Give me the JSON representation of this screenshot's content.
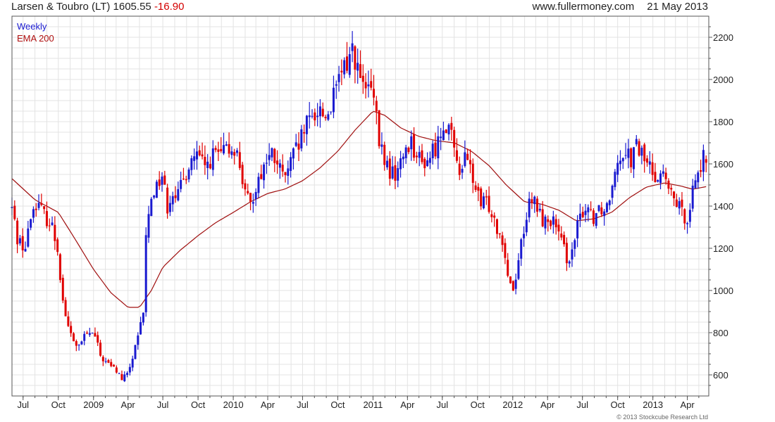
{
  "header": {
    "ticker_name": "Larsen & Toubro (LT)",
    "price": "1605.55",
    "change": "-16.90",
    "site": "www.fullermoney.com",
    "date": "21 May 2013"
  },
  "legend": {
    "weekly": "Weekly",
    "ema": "EMA 200"
  },
  "copyright": "© 2013 Stockcube Research Ltd",
  "colors": {
    "up": "#1a1ad0",
    "down": "#e00000",
    "ema": "#a01010",
    "grid": "#e3e3e3",
    "frame": "#555555",
    "weekly_label": "#1a1ad0",
    "ema_label": "#b01010"
  },
  "chart_data": {
    "type": "candlestick",
    "title": "Larsen & Toubro (LT) 1605.55 -16.90",
    "frequency": "Weekly",
    "x_tick_labels": [
      "Jul",
      "Oct",
      "2009",
      "Apr",
      "Jul",
      "Oct",
      "2010",
      "Apr",
      "Jul",
      "Oct",
      "2011",
      "Apr",
      "Jul",
      "Oct",
      "2012",
      "Apr",
      "Jul",
      "Oct",
      "2013",
      "Apr"
    ],
    "x_tick_dates": [
      "2008-07",
      "2008-10",
      "2009-01",
      "2009-04",
      "2009-07",
      "2009-10",
      "2010-01",
      "2010-04",
      "2010-07",
      "2010-10",
      "2011-01",
      "2011-04",
      "2011-07",
      "2011-10",
      "2012-01",
      "2012-04",
      "2012-07",
      "2012-10",
      "2013-01",
      "2013-04"
    ],
    "y_ticks": [
      600,
      800,
      1000,
      1200,
      1400,
      1600,
      1800,
      2000,
      2200
    ],
    "ylim": [
      500,
      2300
    ],
    "grid": true,
    "legend_position": "top-left",
    "price_path": [
      [
        "2008-06-02",
        1390
      ],
      [
        "2008-06-16",
        1250
      ],
      [
        "2008-07-07",
        1200
      ],
      [
        "2008-07-21",
        1350
      ],
      [
        "2008-08-04",
        1420
      ],
      [
        "2008-08-18",
        1380
      ],
      [
        "2008-09-01",
        1340
      ],
      [
        "2008-09-15",
        1300
      ],
      [
        "2008-09-29",
        1200
      ],
      [
        "2008-10-13",
        950
      ],
      [
        "2008-10-27",
        820
      ],
      [
        "2008-11-10",
        760
      ],
      [
        "2008-11-24",
        730
      ],
      [
        "2008-12-08",
        780
      ],
      [
        "2008-12-22",
        800
      ],
      [
        "2009-01-05",
        780
      ],
      [
        "2009-01-19",
        690
      ],
      [
        "2009-02-02",
        660
      ],
      [
        "2009-02-16",
        640
      ],
      [
        "2009-03-02",
        620
      ],
      [
        "2009-03-16",
        580
      ],
      [
        "2009-03-30",
        600
      ],
      [
        "2009-04-13",
        680
      ],
      [
        "2009-04-27",
        770
      ],
      [
        "2009-05-11",
        900
      ],
      [
        "2009-05-18",
        1250
      ],
      [
        "2009-06-01",
        1450
      ],
      [
        "2009-06-15",
        1500
      ],
      [
        "2009-06-29",
        1550
      ],
      [
        "2009-07-13",
        1400
      ],
      [
        "2009-07-27",
        1480
      ],
      [
        "2009-08-10",
        1450
      ],
      [
        "2009-08-24",
        1520
      ],
      [
        "2009-09-07",
        1600
      ],
      [
        "2009-09-21",
        1640
      ],
      [
        "2009-10-05",
        1620
      ],
      [
        "2009-10-19",
        1580
      ],
      [
        "2009-11-02",
        1620
      ],
      [
        "2009-11-16",
        1650
      ],
      [
        "2009-11-30",
        1640
      ],
      [
        "2009-12-14",
        1660
      ],
      [
        "2010-01-04",
        1680
      ],
      [
        "2010-01-18",
        1600
      ],
      [
        "2010-02-01",
        1450
      ],
      [
        "2010-02-15",
        1400
      ],
      [
        "2010-03-01",
        1500
      ],
      [
        "2010-03-15",
        1560
      ],
      [
        "2010-03-29",
        1620
      ],
      [
        "2010-04-12",
        1640
      ],
      [
        "2010-04-26",
        1600
      ],
      [
        "2010-05-10",
        1540
      ],
      [
        "2010-05-24",
        1560
      ],
      [
        "2010-06-07",
        1640
      ],
      [
        "2010-06-21",
        1680
      ],
      [
        "2010-07-05",
        1760
      ],
      [
        "2010-07-19",
        1800
      ],
      [
        "2010-08-02",
        1840
      ],
      [
        "2010-08-16",
        1860
      ],
      [
        "2010-08-30",
        1820
      ],
      [
        "2010-09-13",
        1880
      ],
      [
        "2010-09-27",
        1950
      ],
      [
        "2010-10-11",
        2030
      ],
      [
        "2010-10-25",
        2080
      ],
      [
        "2010-11-08",
        2150
      ],
      [
        "2010-11-22",
        2050
      ],
      [
        "2010-12-06",
        1950
      ],
      [
        "2010-12-20",
        1960
      ],
      [
        "2011-01-03",
        1900
      ],
      [
        "2011-01-17",
        1700
      ],
      [
        "2011-01-31",
        1620
      ],
      [
        "2011-02-14",
        1560
      ],
      [
        "2011-02-28",
        1550
      ],
      [
        "2011-03-14",
        1600
      ],
      [
        "2011-03-28",
        1680
      ],
      [
        "2011-04-11",
        1710
      ],
      [
        "2011-04-25",
        1640
      ],
      [
        "2011-05-09",
        1600
      ],
      [
        "2011-05-23",
        1620
      ],
      [
        "2011-06-06",
        1660
      ],
      [
        "2011-06-20",
        1700
      ],
      [
        "2011-07-04",
        1800
      ],
      [
        "2011-07-18",
        1780
      ],
      [
        "2011-08-01",
        1650
      ],
      [
        "2011-08-15",
        1580
      ],
      [
        "2011-08-29",
        1620
      ],
      [
        "2011-09-12",
        1580
      ],
      [
        "2011-09-26",
        1480
      ],
      [
        "2011-10-10",
        1400
      ],
      [
        "2011-10-24",
        1420
      ],
      [
        "2011-11-07",
        1380
      ],
      [
        "2011-11-21",
        1300
      ],
      [
        "2011-12-05",
        1250
      ],
      [
        "2011-12-19",
        1080
      ],
      [
        "2012-01-02",
        1000
      ],
      [
        "2012-01-16",
        1150
      ],
      [
        "2012-01-30",
        1300
      ],
      [
        "2012-02-13",
        1400
      ],
      [
        "2012-02-27",
        1420
      ],
      [
        "2012-03-12",
        1360
      ],
      [
        "2012-03-26",
        1320
      ],
      [
        "2012-04-09",
        1340
      ],
      [
        "2012-04-23",
        1300
      ],
      [
        "2012-05-07",
        1220
      ],
      [
        "2012-05-21",
        1160
      ],
      [
        "2012-06-04",
        1170
      ],
      [
        "2012-06-18",
        1300
      ],
      [
        "2012-07-02",
        1380
      ],
      [
        "2012-07-16",
        1400
      ],
      [
        "2012-07-30",
        1350
      ],
      [
        "2012-08-13",
        1400
      ],
      [
        "2012-08-27",
        1380
      ],
      [
        "2012-09-10",
        1450
      ],
      [
        "2012-09-24",
        1600
      ],
      [
        "2012-10-08",
        1640
      ],
      [
        "2012-10-22",
        1680
      ],
      [
        "2012-11-05",
        1620
      ],
      [
        "2012-11-19",
        1680
      ],
      [
        "2012-12-03",
        1650
      ],
      [
        "2012-12-17",
        1600
      ],
      [
        "2013-01-07",
        1550
      ],
      [
        "2013-01-21",
        1560
      ],
      [
        "2013-02-04",
        1520
      ],
      [
        "2013-02-18",
        1440
      ],
      [
        "2013-03-04",
        1420
      ],
      [
        "2013-03-18",
        1360
      ],
      [
        "2013-04-01",
        1350
      ],
      [
        "2013-04-15",
        1480
      ],
      [
        "2013-04-29",
        1570
      ],
      [
        "2013-05-13",
        1622
      ],
      [
        "2013-05-20",
        1605
      ]
    ],
    "ema200_path": [
      [
        "2008-06-02",
        1530
      ],
      [
        "2008-08-01",
        1430
      ],
      [
        "2008-10-01",
        1370
      ],
      [
        "2008-11-15",
        1240
      ],
      [
        "2009-01-01",
        1100
      ],
      [
        "2009-02-15",
        990
      ],
      [
        "2009-04-01",
        920
      ],
      [
        "2009-05-01",
        920
      ],
      [
        "2009-06-01",
        1000
      ],
      [
        "2009-07-01",
        1110
      ],
      [
        "2009-08-15",
        1190
      ],
      [
        "2009-10-01",
        1260
      ],
      [
        "2009-11-15",
        1320
      ],
      [
        "2010-01-01",
        1370
      ],
      [
        "2010-02-15",
        1420
      ],
      [
        "2010-04-01",
        1460
      ],
      [
        "2010-05-15",
        1480
      ],
      [
        "2010-07-01",
        1520
      ],
      [
        "2010-08-15",
        1580
      ],
      [
        "2010-10-01",
        1660
      ],
      [
        "2010-11-15",
        1760
      ],
      [
        "2011-01-01",
        1850
      ],
      [
        "2011-02-01",
        1830
      ],
      [
        "2011-03-15",
        1770
      ],
      [
        "2011-05-01",
        1730
      ],
      [
        "2011-06-15",
        1710
      ],
      [
        "2011-08-01",
        1700
      ],
      [
        "2011-09-15",
        1660
      ],
      [
        "2011-11-01",
        1590
      ],
      [
        "2011-12-15",
        1500
      ],
      [
        "2012-02-01",
        1420
      ],
      [
        "2012-03-15",
        1410
      ],
      [
        "2012-05-01",
        1380
      ],
      [
        "2012-06-15",
        1330
      ],
      [
        "2012-08-01",
        1340
      ],
      [
        "2012-09-15",
        1370
      ],
      [
        "2012-11-01",
        1440
      ],
      [
        "2012-12-15",
        1490
      ],
      [
        "2013-02-01",
        1510
      ],
      [
        "2013-03-15",
        1495
      ],
      [
        "2013-04-15",
        1480
      ],
      [
        "2013-05-20",
        1492
      ]
    ]
  }
}
